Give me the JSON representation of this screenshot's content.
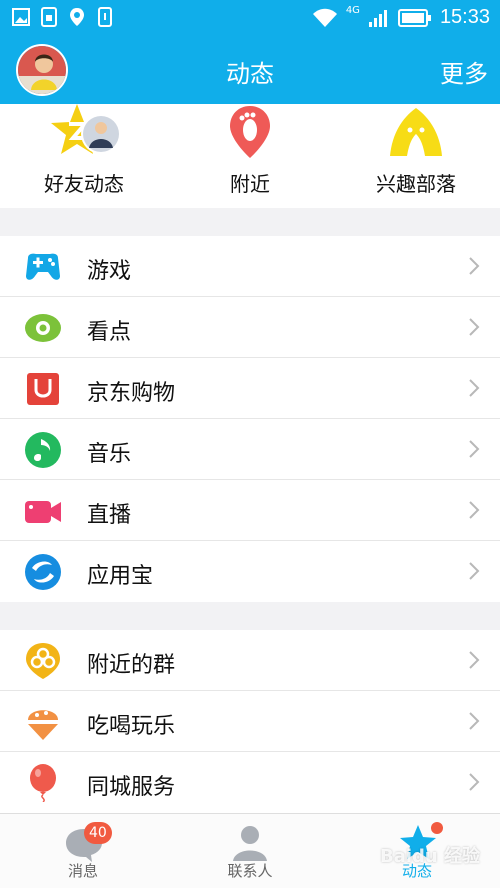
{
  "status_bar": {
    "time": "15:33",
    "network": "4G"
  },
  "header": {
    "title": "动态",
    "more_label": "更多"
  },
  "shortcuts": [
    {
      "label": "好友动态",
      "icon": "friend-feed-icon"
    },
    {
      "label": "附近",
      "icon": "nearby-location-icon"
    },
    {
      "label": "兴趣部落",
      "icon": "tent-icon"
    }
  ],
  "group1": [
    {
      "label": "游戏",
      "icon": "gamepad-icon",
      "color": "#13a7e6"
    },
    {
      "label": "看点",
      "icon": "eye-icon",
      "color": "#7cc23a"
    },
    {
      "label": "京东购物",
      "icon": "jd-shopping-icon",
      "color": "#e4433a"
    },
    {
      "label": "音乐",
      "icon": "music-note-icon",
      "color": "#23b95f"
    },
    {
      "label": "直播",
      "icon": "video-camera-icon",
      "color": "#ee3f72"
    },
    {
      "label": "应用宝",
      "icon": "app-store-icon",
      "color": "#168de0"
    }
  ],
  "group2": [
    {
      "label": "附近的群",
      "icon": "nearby-group-icon",
      "color": "#f2b417"
    },
    {
      "label": "吃喝玩乐",
      "icon": "food-fun-icon",
      "color": "#f29143"
    },
    {
      "label": "同城服务",
      "icon": "balloon-icon",
      "color": "#ef5a4c"
    }
  ],
  "tabs": [
    {
      "label": "消息",
      "badge": "40"
    },
    {
      "label": "联系人"
    },
    {
      "label": "动态",
      "active": true
    }
  ],
  "watermark": "Baidu 经验",
  "colors": {
    "brand": "#10aeea",
    "badge": "#f15a40"
  }
}
